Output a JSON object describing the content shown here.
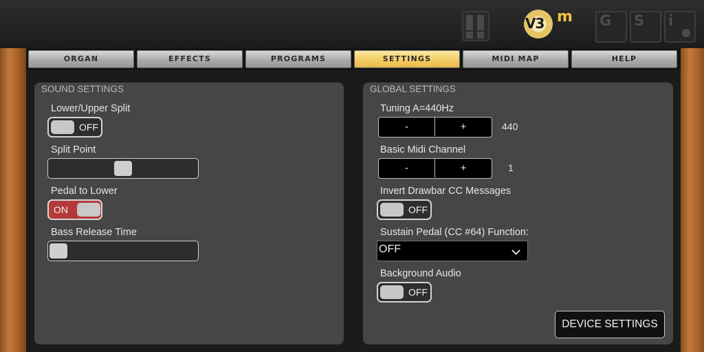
{
  "header": {
    "logo_text": "V3",
    "logo_suffix": "m",
    "buttons": [
      {
        "id": "G",
        "label": "G"
      },
      {
        "id": "S",
        "label": "S"
      },
      {
        "id": "i",
        "label": "i"
      }
    ]
  },
  "tabs": [
    {
      "label": "ORGAN",
      "active": false
    },
    {
      "label": "EFFECTS",
      "active": false
    },
    {
      "label": "PROGRAMS",
      "active": false
    },
    {
      "label": "SETTINGS",
      "active": true
    },
    {
      "label": "MIDI MAP",
      "active": false
    },
    {
      "label": "HELP",
      "active": false
    }
  ],
  "sound_settings": {
    "title": "SOUND SETTINGS",
    "lower_upper_split": {
      "label": "Lower/Upper Split",
      "state": "OFF"
    },
    "split_point": {
      "label": "Split Point",
      "level": 0.5
    },
    "pedal_to_lower": {
      "label": "Pedal to Lower",
      "state": "ON"
    },
    "bass_release_time": {
      "label": "Bass Release Time",
      "level": 0.0
    }
  },
  "global_settings": {
    "title": "GLOBAL SETTINGS",
    "tuning": {
      "label": "Tuning A=440Hz",
      "minus": "-",
      "plus": "+",
      "value": "440"
    },
    "midi_channel": {
      "label": "Basic Midi Channel",
      "minus": "-",
      "plus": "+",
      "value": "1"
    },
    "invert_drawbar": {
      "label": "Invert Drawbar CC Messages",
      "state": "OFF"
    },
    "sustain_pedal": {
      "label": "Sustain Pedal (CC #64) Function:",
      "selected": "OFF"
    },
    "background_audio": {
      "label": "Background Audio",
      "state": "OFF"
    },
    "device_settings_button": "DEVICE SETTINGS"
  },
  "colors": {
    "active_tab": "#f4cd63",
    "toggle_on": "#b43a3a",
    "panel": "#464646",
    "logo_accent": "#f0c23d"
  }
}
